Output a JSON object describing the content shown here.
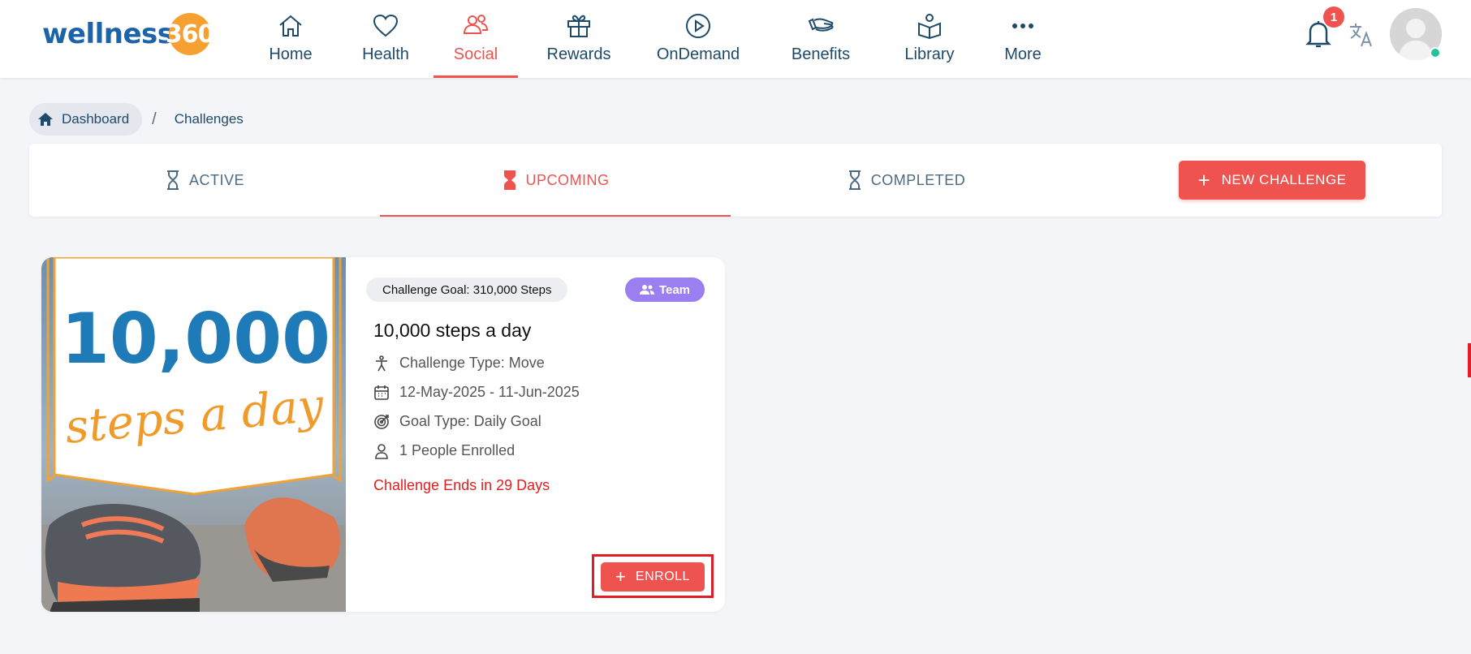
{
  "brand": {
    "name": "wellness",
    "number": "360"
  },
  "nav": {
    "items": [
      {
        "label": "Home",
        "icon": "home-icon"
      },
      {
        "label": "Health",
        "icon": "heart-icon"
      },
      {
        "label": "Social",
        "icon": "people-icon",
        "active": true
      },
      {
        "label": "Rewards",
        "icon": "gift-icon"
      },
      {
        "label": "OnDemand",
        "icon": "play-circle-icon"
      },
      {
        "label": "Benefits",
        "icon": "hand-icon"
      },
      {
        "label": "Library",
        "icon": "book-reader-icon"
      },
      {
        "label": "More",
        "icon": "more-dots-icon"
      }
    ]
  },
  "header": {
    "notification_count": "1",
    "translate_icon": "translate-icon",
    "avatar_icon": "user-avatar-icon",
    "status_color": "#1fc49a"
  },
  "breadcrumb": {
    "home": "Dashboard",
    "separator": "/",
    "current": "Challenges"
  },
  "tabs": [
    {
      "label": "ACTIVE",
      "icon": "hourglass-icon"
    },
    {
      "label": "UPCOMING",
      "icon": "hourglass-filled-icon",
      "active": true
    },
    {
      "label": "COMPLETED",
      "icon": "hourglass-icon"
    }
  ],
  "new_challenge": {
    "label": "NEW CHALLENGE",
    "plus": "+"
  },
  "challenge": {
    "image": {
      "line1": "10,000",
      "line2": "steps a day"
    },
    "goal": "Challenge Goal: 310,000 Steps",
    "badge": "Team",
    "title": "10,000 steps a day",
    "type": "Challenge Type: Move",
    "dates": "12-May-2025 - 11-Jun-2025",
    "goal_type": "Goal Type: Daily Goal",
    "enrolled": "1 People Enrolled",
    "ends": "Challenge Ends in 29 Days",
    "enroll_label": "ENROLL",
    "enroll_plus": "+"
  },
  "colors": {
    "accent": "#ef5350",
    "primary": "#1e4a6a",
    "team": "#9b7ef0",
    "brand_blue": "#1d63a8",
    "brand_orange": "#f6a032"
  }
}
